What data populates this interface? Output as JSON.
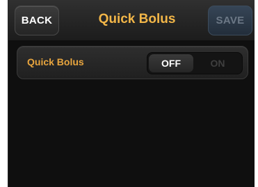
{
  "header": {
    "back_label": "BACK",
    "title": "Quick Bolus",
    "save_label": "SAVE"
  },
  "settings": {
    "quick_bolus": {
      "label": "Quick Bolus",
      "off_label": "OFF",
      "on_label": "ON",
      "selected": "OFF"
    }
  },
  "colors": {
    "title_accent": "#f2b648",
    "label_accent": "#e8a53e",
    "background": "#0f0f0f"
  }
}
